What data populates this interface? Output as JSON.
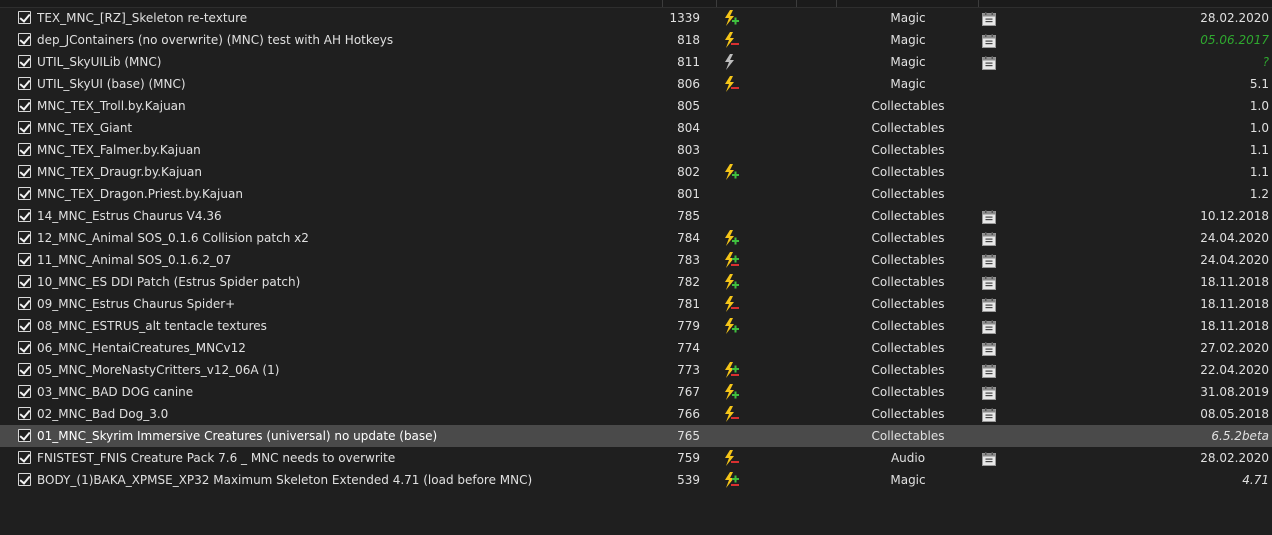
{
  "colors": {
    "background": "#1f1f1f",
    "selected_row": "#4a4a4a",
    "text": "#e0e0e0",
    "outdated_version": "#2fa82f",
    "flag_bolt": "#f5c518",
    "flag_plus": "#3fbf3f",
    "flag_minus": "#d83030"
  },
  "mods": [
    {
      "checked": true,
      "name": "TEX_MNC_[RZ]_Skeleton re-texture",
      "priority": "1339",
      "flag": "bolt-plus-icon",
      "category": "Magic",
      "nexus": true,
      "version": "28.02.2020",
      "version_style": "normal"
    },
    {
      "checked": true,
      "name": "dep_JContainers (no overwrite) (MNC) test with AH Hotkeys",
      "priority": "818",
      "flag": "bolt-minus-icon",
      "category": "Magic",
      "nexus": true,
      "version": "05.06.2017",
      "version_style": "green"
    },
    {
      "checked": true,
      "name": "UTIL_SkyUILib (MNC)",
      "priority": "811",
      "flag": "bolt-grey-icon",
      "category": "Magic",
      "nexus": true,
      "version": "?",
      "version_style": "green"
    },
    {
      "checked": true,
      "name": "UTIL_SkyUI (base) (MNC)",
      "priority": "806",
      "flag": "bolt-minus-icon",
      "category": "Magic",
      "nexus": false,
      "version": "5.1",
      "version_style": "normal"
    },
    {
      "checked": true,
      "name": "MNC_TEX_Troll.by.Kajuan",
      "priority": "805",
      "flag": "",
      "category": "Collectables",
      "nexus": false,
      "version": "1.0",
      "version_style": "normal"
    },
    {
      "checked": true,
      "name": "MNC_TEX_Giant",
      "priority": "804",
      "flag": "",
      "category": "Collectables",
      "nexus": false,
      "version": "1.0",
      "version_style": "normal"
    },
    {
      "checked": true,
      "name": "MNC_TEX_Falmer.by.Kajuan",
      "priority": "803",
      "flag": "",
      "category": "Collectables",
      "nexus": false,
      "version": "1.1",
      "version_style": "normal"
    },
    {
      "checked": true,
      "name": "MNC_TEX_Draugr.by.Kajuan",
      "priority": "802",
      "flag": "bolt-plus-icon",
      "category": "Collectables",
      "nexus": false,
      "version": "1.1",
      "version_style": "normal"
    },
    {
      "checked": true,
      "name": "MNC_TEX_Dragon.Priest.by.Kajuan",
      "priority": "801",
      "flag": "",
      "category": "Collectables",
      "nexus": false,
      "version": "1.2",
      "version_style": "normal"
    },
    {
      "checked": true,
      "name": "14_MNC_Estrus Chaurus V4.36",
      "priority": "785",
      "flag": "",
      "category": "Collectables",
      "nexus": true,
      "version": "10.12.2018",
      "version_style": "normal"
    },
    {
      "checked": true,
      "name": "12_MNC_Animal SOS_0.1.6 Collision patch x2",
      "priority": "784",
      "flag": "bolt-plus-icon",
      "category": "Collectables",
      "nexus": true,
      "version": "24.04.2020",
      "version_style": "normal"
    },
    {
      "checked": true,
      "name": "11_MNC_Animal SOS_0.1.6.2_07",
      "priority": "783",
      "flag": "bolt-mixed-icon",
      "category": "Collectables",
      "nexus": true,
      "version": "24.04.2020",
      "version_style": "normal"
    },
    {
      "checked": true,
      "name": "10_MNC_ES DDI Patch (Estrus Spider patch)",
      "priority": "782",
      "flag": "bolt-plus-icon",
      "category": "Collectables",
      "nexus": true,
      "version": "18.11.2018",
      "version_style": "normal"
    },
    {
      "checked": true,
      "name": "09_MNC_Estrus Chaurus Spider+",
      "priority": "781",
      "flag": "bolt-minus-icon",
      "category": "Collectables",
      "nexus": true,
      "version": "18.11.2018",
      "version_style": "normal"
    },
    {
      "checked": true,
      "name": "08_MNC_ESTRUS_alt tentacle textures",
      "priority": "779",
      "flag": "bolt-plus-icon",
      "category": "Collectables",
      "nexus": true,
      "version": "18.11.2018",
      "version_style": "normal"
    },
    {
      "checked": true,
      "name": "06_MNC_HentaiCreatures_MNCv12",
      "priority": "774",
      "flag": "",
      "category": "Collectables",
      "nexus": true,
      "version": "27.02.2020",
      "version_style": "normal"
    },
    {
      "checked": true,
      "name": "05_MNC_MoreNastyCritters_v12_06A (1)",
      "priority": "773",
      "flag": "bolt-mixed-icon",
      "category": "Collectables",
      "nexus": true,
      "version": "22.04.2020",
      "version_style": "normal"
    },
    {
      "checked": true,
      "name": "03_MNC_BAD DOG canine",
      "priority": "767",
      "flag": "bolt-plus-icon",
      "category": "Collectables",
      "nexus": true,
      "version": "31.08.2019",
      "version_style": "normal"
    },
    {
      "checked": true,
      "name": "02_MNC_Bad Dog_3.0",
      "priority": "766",
      "flag": "bolt-minus-icon",
      "category": "Collectables",
      "nexus": true,
      "version": "08.05.2018",
      "version_style": "normal"
    },
    {
      "checked": true,
      "name": "01_MNC_Skyrim Immersive Creatures (universal) no update (base)",
      "priority": "765",
      "flag": "",
      "category": "Collectables",
      "nexus": false,
      "version": "6.5.2beta",
      "version_style": "italic",
      "selected": true
    },
    {
      "checked": true,
      "name": "FNISTEST_FNIS Creature Pack 7.6 _ MNC needs to overwrite",
      "priority": "759",
      "flag": "bolt-minus-icon",
      "category": "Audio",
      "nexus": true,
      "version": "28.02.2020",
      "version_style": "normal"
    },
    {
      "checked": true,
      "name": "BODY_(1)BAKA_XPMSE_XP32 Maximum Skeleton Extended 4.71 (load before MNC)",
      "priority": "539",
      "flag": "bolt-mixed-icon",
      "category": "Magic",
      "nexus": false,
      "version": "4.71",
      "version_style": "italic"
    }
  ]
}
